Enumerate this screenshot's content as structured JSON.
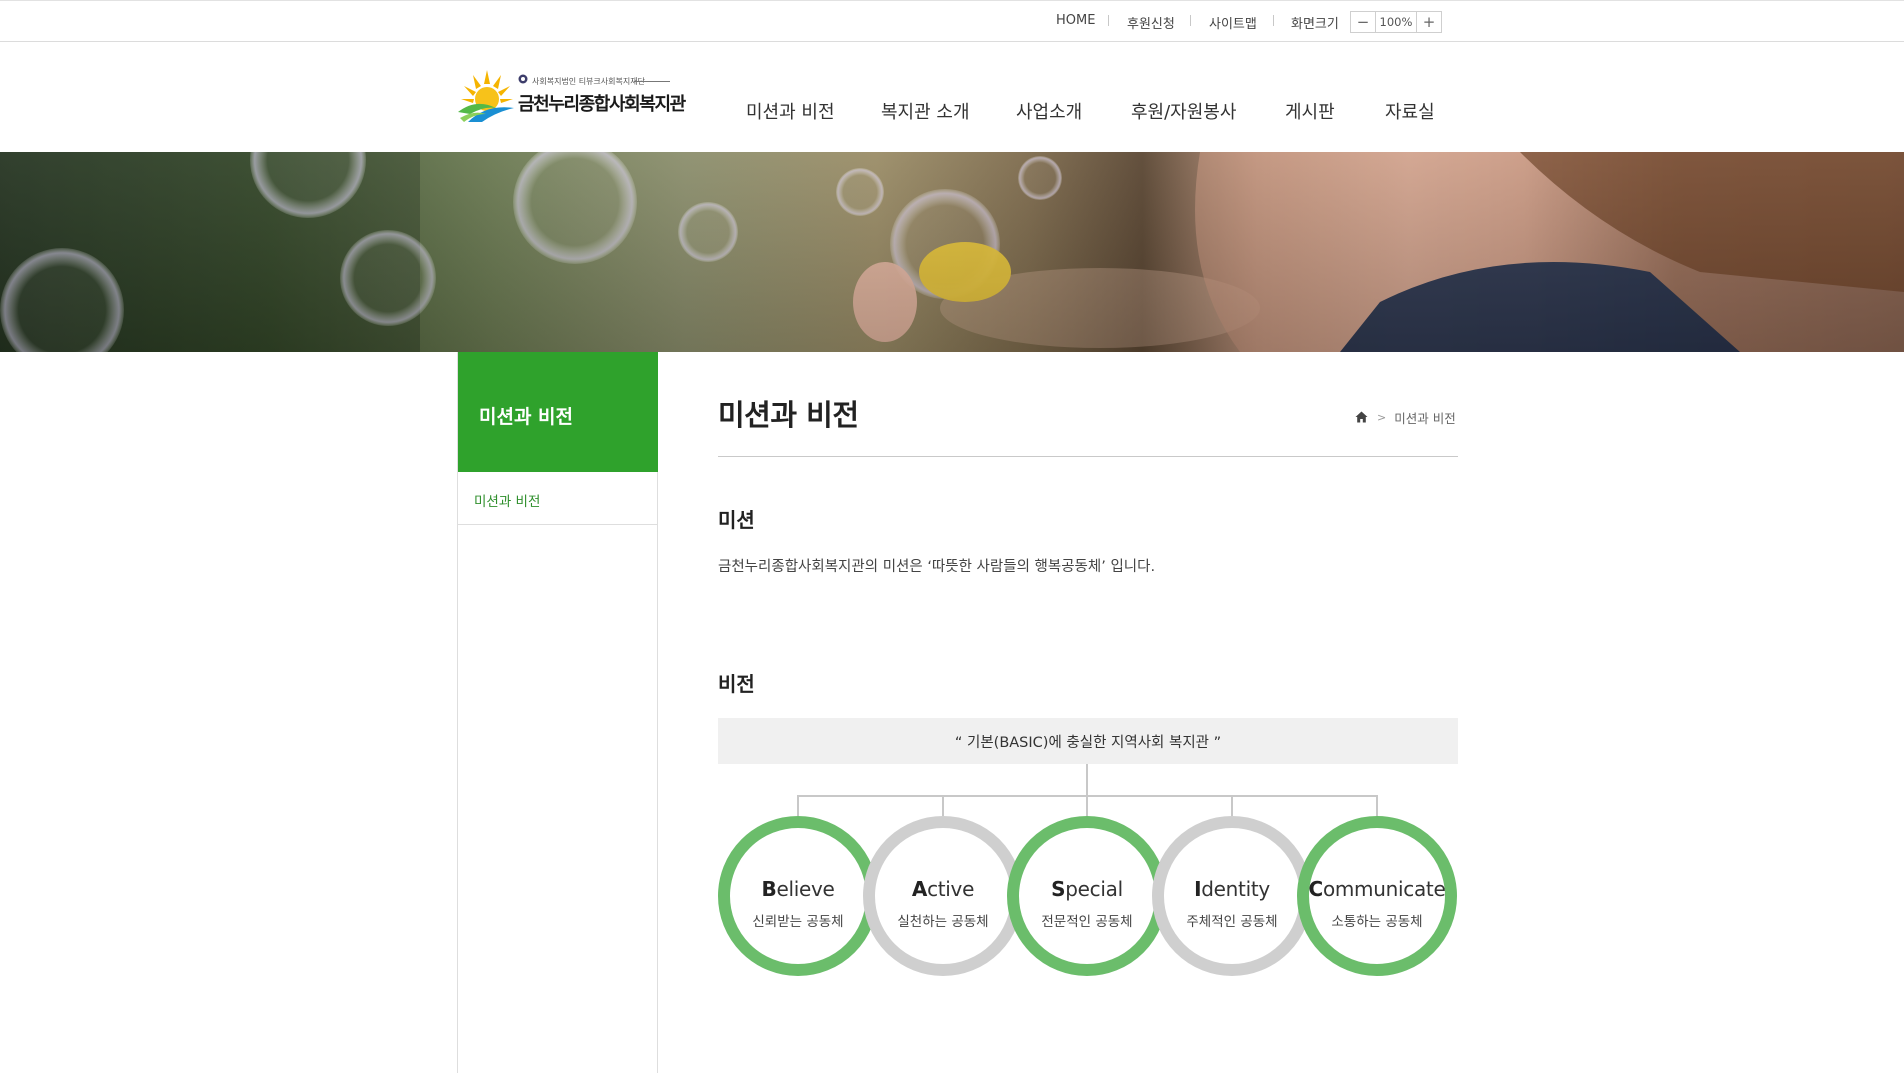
{
  "util_nav": {
    "home": "HOME",
    "donate": "후원신청",
    "sitemap": "사이트맵",
    "screen_size": "화면크기",
    "zoom_out": "−",
    "zoom_value": "100%",
    "zoom_in": "+"
  },
  "logo": {
    "sub": "사회복지법인 티뷰크사회복지재단",
    "title": "금천누리종합사회복지관"
  },
  "gnb": [
    "미션과 비전",
    "복지관 소개",
    "사업소개",
    "후원/자원봉사",
    "게시판",
    "자료실"
  ],
  "lnb": {
    "title": "미션과 비전",
    "items": [
      "미션과 비전"
    ]
  },
  "content": {
    "title": "미션과 비전",
    "breadcrumb": {
      "current": "미션과 비전"
    },
    "mission_heading": "미션",
    "mission_text": "금천누리종합사회복지관의 미션은 ‘따뜻한 사람들의 행복공동체’ 입니다.",
    "vision_heading": "비전",
    "vision_statement": "“ 기본(BASIC)에 충실한 지역사회 복지관 ”",
    "values": [
      {
        "initial": "B",
        "rest": "elieve",
        "ko": "신뢰받는 공동체"
      },
      {
        "initial": "A",
        "rest": "ctive",
        "ko": "실천하는 공동체"
      },
      {
        "initial": "S",
        "rest": "pecial",
        "ko": "전문적인 공동체"
      },
      {
        "initial": "I",
        "rest": "dentity",
        "ko": "주체적인 공동체"
      },
      {
        "initial": "C",
        "rest": "ommunicate",
        "ko": "소통하는 공동체"
      }
    ]
  },
  "icons": {
    "home": "home-icon",
    "breadcrumb_home": "home-icon",
    "logo": "sun-logo-icon"
  },
  "colors": {
    "green": "#2fa22c",
    "ring_green": "#6bbd6b",
    "ring_gray": "#cfcfcf"
  }
}
